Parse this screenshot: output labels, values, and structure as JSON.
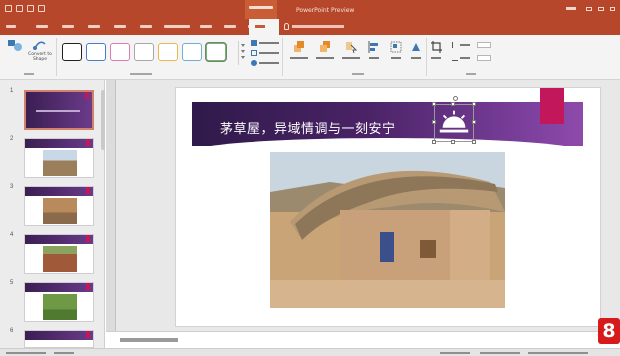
{
  "app": {
    "title": "PowerPoint Preview",
    "context_tab": "",
    "sign_in": ""
  },
  "tabs": [
    "",
    "",
    "",
    "",
    "",
    "",
    "",
    "",
    "",
    "",
    ""
  ],
  "active_tab_index": 10,
  "tell_me": "",
  "ribbon": {
    "change_shape_label": "",
    "convert_label": "Convert to Shape",
    "group_labels": {
      "change": "",
      "shape_styles": "",
      "arrange": "",
      "size": ""
    },
    "fill_label": "",
    "outline_label": "",
    "effects_label": "",
    "bring_forward": "",
    "send_backward": "",
    "selection_pane": "",
    "align": "",
    "group": "",
    "rotate": "",
    "crop": "",
    "height_label": "",
    "height_value": "",
    "width_label": "",
    "width_value": ""
  },
  "thumbnails": [
    {
      "number": "1",
      "kind": "title"
    },
    {
      "number": "2",
      "kind": "photo"
    },
    {
      "number": "3",
      "kind": "photo"
    },
    {
      "number": "4",
      "kind": "photo"
    },
    {
      "number": "5",
      "kind": "photo"
    },
    {
      "number": "6",
      "kind": "photo"
    }
  ],
  "slide": {
    "title": "茅草屋，异域情调与一刻安宁",
    "photo_caption": ""
  },
  "notes_placeholder": "",
  "step_badge": "8",
  "colors": {
    "app_accent": "#b7472a",
    "banner_dark": "#2f1a4a",
    "banner_light": "#8e4aaa",
    "pink_tag": "#c2185b",
    "badge": "#d71b1b"
  }
}
